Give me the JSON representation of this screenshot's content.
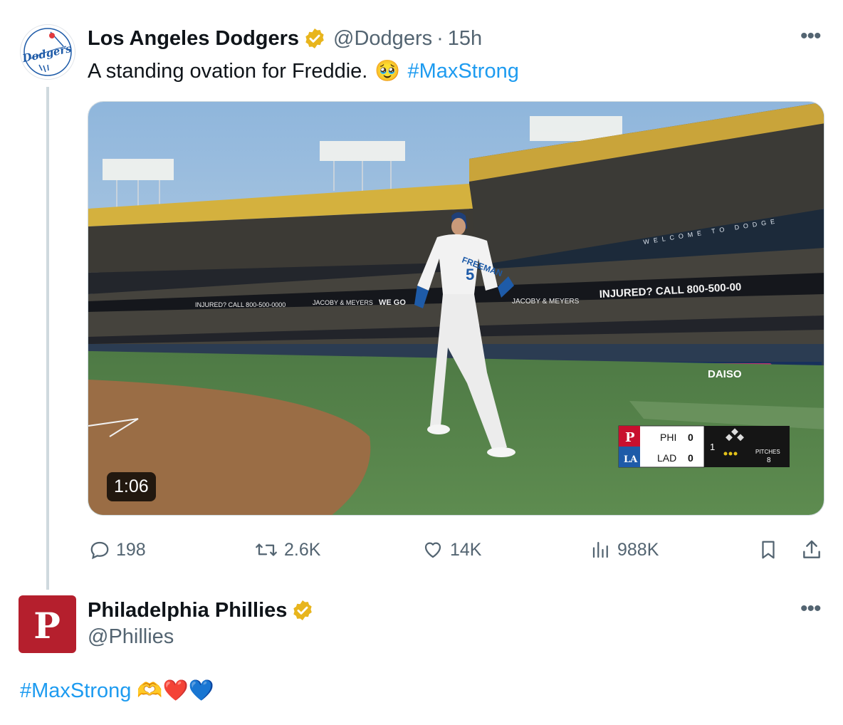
{
  "tweet1": {
    "author_name": "Los Angeles Dodgers",
    "avatar_text": "Dodgers",
    "handle": "@Dodgers",
    "separator": "·",
    "time": "15h",
    "text": "A standing ovation for Freddie.",
    "emoji": "🥹",
    "hashtag": "#MaxStrong",
    "video": {
      "duration": "1:06",
      "jersey_name": "FREEMAN",
      "jersey_number": "5",
      "ad_right": "INJURED? CALL 800-500-00",
      "ad_left": "INJURED? CALL 800-500-0000",
      "ad_jacoby": "JACOBY & MEYERS",
      "ad_wego": "WE GO",
      "ad_daiso": "DAISO",
      "ad_welcome": "WELCOME TO DODGE",
      "scorebug": {
        "team1": "PHI",
        "score1": "0",
        "team2": "LAD",
        "score2": "0",
        "inning": "1",
        "pitches_label": "PITCHES",
        "pitches": "8"
      }
    },
    "actions": {
      "replies": "198",
      "reposts": "2.6K",
      "likes": "14K",
      "views": "988K"
    }
  },
  "tweet2": {
    "author_name": "Philadelphia Phillies",
    "handle": "@Phillies",
    "avatar_letter": "P",
    "hashtag": "#MaxStrong",
    "emojis": "🫶❤️💙"
  },
  "colors": {
    "link": "#1d9bf0",
    "verified": "#e8b51d",
    "muted": "#536471",
    "phillies_red": "#b51f2d",
    "dodger_blue": "#1e5ba8"
  }
}
